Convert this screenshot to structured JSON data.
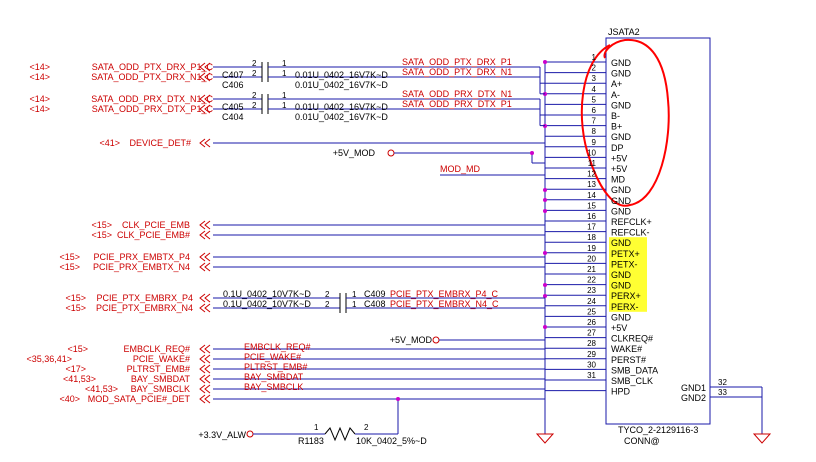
{
  "colors": {
    "wire": "#1a1aa8",
    "net_label": "#cc0000",
    "highlight": "#ffff33",
    "markup": "#ff0000"
  },
  "connector": {
    "refdes": "JSATA2",
    "part_number": "TYCO_2-2129116-3",
    "footprint": "CONN@",
    "pins": [
      {
        "num": "1",
        "name": "GND"
      },
      {
        "num": "2",
        "name": "GND"
      },
      {
        "num": "3",
        "name": "A+"
      },
      {
        "num": "4",
        "name": "A-"
      },
      {
        "num": "5",
        "name": "GND"
      },
      {
        "num": "6",
        "name": "B-"
      },
      {
        "num": "7",
        "name": "B+"
      },
      {
        "num": "8",
        "name": "GND"
      },
      {
        "num": "9",
        "name": "DP"
      },
      {
        "num": "10",
        "name": "+5V"
      },
      {
        "num": "11",
        "name": "+5V"
      },
      {
        "num": "12",
        "name": "MD"
      },
      {
        "num": "13",
        "name": "GND"
      },
      {
        "num": "14",
        "name": "GND"
      },
      {
        "num": "15",
        "name": "GND"
      },
      {
        "num": "16",
        "name": "REFCLK+"
      },
      {
        "num": "17",
        "name": "REFCLK-"
      },
      {
        "num": "18",
        "name": "GND"
      },
      {
        "num": "19",
        "name": "PETX+"
      },
      {
        "num": "20",
        "name": "PETX-"
      },
      {
        "num": "21",
        "name": "GND"
      },
      {
        "num": "22",
        "name": "GND"
      },
      {
        "num": "23",
        "name": "PERX+"
      },
      {
        "num": "24",
        "name": "PERX-"
      },
      {
        "num": "25",
        "name": "GND"
      },
      {
        "num": "26",
        "name": "+5V"
      },
      {
        "num": "27",
        "name": "CLKREQ#"
      },
      {
        "num": "28",
        "name": "WAKE#"
      },
      {
        "num": "29",
        "name": "PERST#"
      },
      {
        "num": "30",
        "name": "SMB_DATA"
      },
      {
        "num": "31",
        "name": "SMB_CLK"
      },
      {
        "num": "",
        "name": "HPD"
      }
    ],
    "gnd_pins": [
      {
        "num": "32",
        "name": "GND1"
      },
      {
        "num": "33",
        "name": "GND2"
      }
    ]
  },
  "left_nets": [
    {
      "ref": "<14>",
      "name": "SATA_ODD_PTX_DRX_P1_C"
    },
    {
      "ref": "<14>",
      "name": "SATA_ODD_PTX_DRX_N1_C"
    },
    {
      "ref": "<14>",
      "name": "SATA_ODD_PRX_DTX_N1_C"
    },
    {
      "ref": "<14>",
      "name": "SATA_ODD_PRX_DTX_P1_C"
    },
    {
      "ref": "<41>",
      "name": "DEVICE_DET#"
    },
    {
      "ref": "<15>",
      "name": "CLK_PCIE_EMB"
    },
    {
      "ref": "<15>",
      "name": "CLK_PCIE_EMB#"
    },
    {
      "ref": "<15>",
      "name": "PCIE_PRX_EMBTX_P4"
    },
    {
      "ref": "<15>",
      "name": "PCIE_PRX_EMBTX_N4"
    },
    {
      "ref": "<15>",
      "name": "PCIE_PTX_EMBRX_P4"
    },
    {
      "ref": "<15>",
      "name": "PCIE_PTX_EMBRX_N4"
    },
    {
      "ref": "<15>",
      "name": "EMBCLK_REQ#"
    },
    {
      "ref": "<35,36,41>",
      "name": "PCIE_WAKE#"
    },
    {
      "ref": "<17>",
      "name": "PLTRST_EMB#"
    },
    {
      "ref": "<41,53>",
      "name": "BAY_SMBDAT"
    },
    {
      "ref": "<41,53>",
      "name": "BAY_SMBCLK"
    },
    {
      "ref": "<40>",
      "name": "MOD_SATA_PCIE#_DET"
    }
  ],
  "caps_top": [
    {
      "ref": "C407",
      "value": "0.01U_0402_16V7K~D",
      "pin_a": "2",
      "pin_b": "1"
    },
    {
      "ref": "C406",
      "value": "0.01U_0402_16V7K~D",
      "pin_a": "2",
      "pin_b": "1"
    },
    {
      "ref": "C405",
      "value": "0.01U_0402_16V7K~D",
      "pin_a": "2",
      "pin_b": "1"
    },
    {
      "ref": "C404",
      "value": "0.01U_0402_16V7K~D",
      "pin_a": "2",
      "pin_b": "1"
    }
  ],
  "caps_pcie": [
    {
      "ref": "C409",
      "value": "0.1U_0402_10V7K~D",
      "pin_a": "2",
      "pin_b": "1"
    },
    {
      "ref": "C408",
      "value": "0.1U_0402_10V7K~D",
      "pin_a": "2",
      "pin_b": "1"
    }
  ],
  "mid_nets": [
    {
      "name": "SATA_ODD_PTX_DRX_P1"
    },
    {
      "name": "SATA_ODD_PTX_DRX_N1"
    },
    {
      "name": "SATA_ODD_PRX_DTX_N1"
    },
    {
      "name": "SATA_ODD_PRX_DTX_P1"
    },
    {
      "name": "MOD_MD"
    },
    {
      "name": "PCIE_PTX_EMBRX_P4_C"
    },
    {
      "name": "PCIE_PTX_EMBRX_N4_C"
    },
    {
      "name": "EMBCLK_REQ#"
    },
    {
      "name": "PCIE_WAKE#"
    },
    {
      "name": "PLTRST_EMB#"
    },
    {
      "name": "BAY_SMBDAT"
    },
    {
      "name": "BAY_SMBCLK"
    }
  ],
  "power": {
    "p5v_a": "+5V_MOD",
    "p5v_b": "+5V_MOD",
    "p3v3": "+3.3V_ALW"
  },
  "resistor": {
    "ref": "R1183",
    "value": "10K_0402_5%~D",
    "pin_a": "1",
    "pin_b": "2"
  }
}
